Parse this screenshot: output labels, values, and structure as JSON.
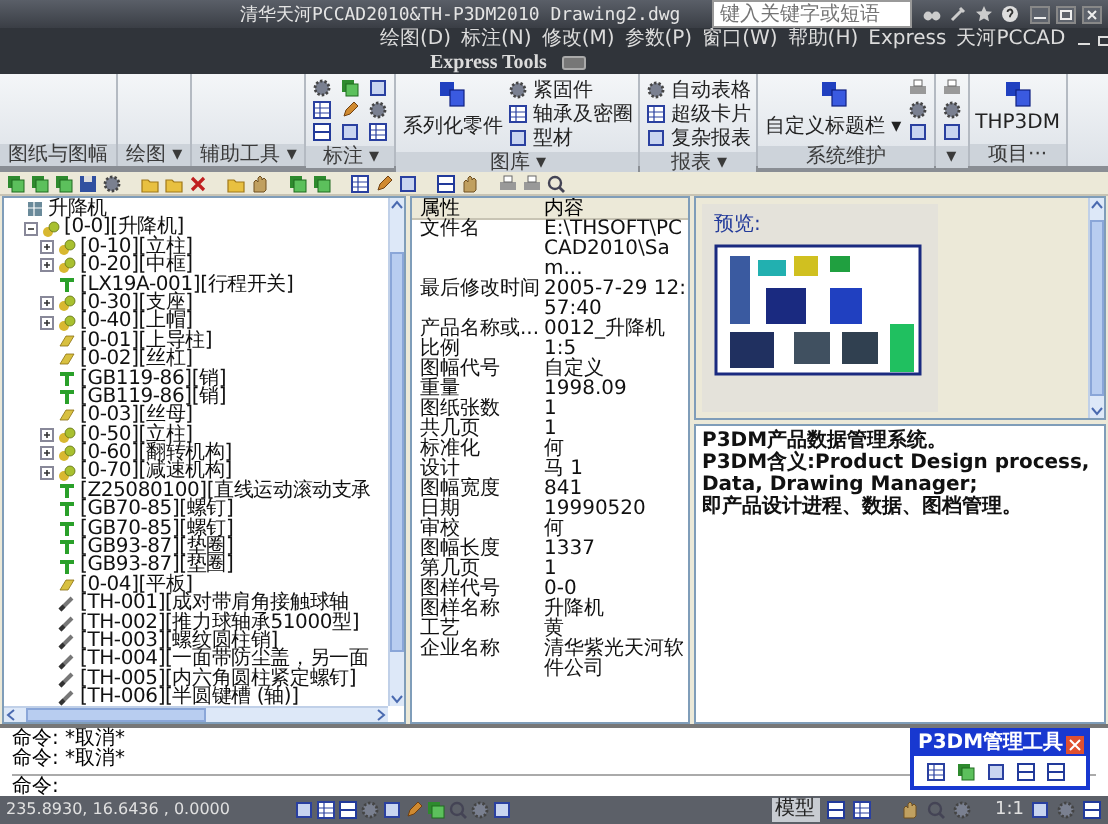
{
  "window": {
    "title": "清华天河PCCAD2010&TH-P3DM2010  Drawing2.dwg",
    "search": {
      "placeholder": "键入关键字或短语"
    }
  },
  "menu_bar": [
    "绘图(D)",
    "标注(N)",
    "修改(M)",
    "参数(P)",
    "窗口(W)",
    "帮助(H)",
    "Express",
    "天河PCCAD"
  ],
  "ribbon_tabs": [
    "Express Tools"
  ],
  "ribbon_panels": [
    {
      "title": "图纸与图幅",
      "kind": "empty"
    },
    {
      "title": "绘图 ▾",
      "kind": "empty"
    },
    {
      "title": "辅助工具 ▾",
      "kind": "empty"
    },
    {
      "title": "标注 ▾",
      "kind": "icon_grid"
    },
    {
      "title": "图库 ▾",
      "kind": "buttons",
      "large": "系列化零件",
      "buttons": [
        "紧固件",
        "轴承及密圈",
        "型材"
      ]
    },
    {
      "title": "报表 ▾",
      "kind": "buttons",
      "buttons": [
        "自动表格",
        "超级卡片",
        "复杂报表"
      ]
    },
    {
      "title": "系统维护",
      "kind": "icon_column",
      "large": "自定义标题栏 ▾"
    },
    {
      "title": "▾",
      "kind": "icon_column"
    },
    {
      "title": "项目···",
      "kind": "buttons",
      "large": "THP3DM"
    }
  ],
  "tree": {
    "label": "升降机",
    "kind": "model",
    "children": [
      {
        "label": "[0-0][升降机]",
        "kind": "assembly",
        "expanded": true,
        "children": [
          {
            "label": "[0-10][立柱]",
            "kind": "assembly",
            "expanded": false
          },
          {
            "label": "[0-20][中框]",
            "kind": "assembly",
            "expanded": false
          },
          {
            "label": "[LX19A-001][行程开关]",
            "kind": "part"
          },
          {
            "label": "[0-30][支座]",
            "kind": "assembly",
            "expanded": false
          },
          {
            "label": "[0-40][上帽]",
            "kind": "assembly",
            "expanded": false
          },
          {
            "label": "[0-01][上导柱]",
            "kind": "plate"
          },
          {
            "label": "[0-02][丝杠]",
            "kind": "plate"
          },
          {
            "label": "[GB119-86][销]",
            "kind": "part"
          },
          {
            "label": "[GB119-86][销]",
            "kind": "part"
          },
          {
            "label": "[0-03][丝母]",
            "kind": "plate"
          },
          {
            "label": "[0-50][立柱]",
            "kind": "assembly",
            "expanded": false
          },
          {
            "label": "[0-60][翻转机构]",
            "kind": "assembly",
            "expanded": false
          },
          {
            "label": "[0-70][减速机构]",
            "kind": "assembly",
            "expanded": false
          },
          {
            "label": "[Z25080100][直线运动滚动支承",
            "kind": "part"
          },
          {
            "label": "[GB70-85][螺钉]",
            "kind": "part"
          },
          {
            "label": "[GB70-85][螺钉]",
            "kind": "part"
          },
          {
            "label": "[GB93-87][垫圈]",
            "kind": "part"
          },
          {
            "label": "[GB93-87][垫圈]",
            "kind": "part"
          },
          {
            "label": "[0-04][平板]",
            "kind": "plate"
          },
          {
            "label": "[TH-001][成对带肩角接触球轴",
            "kind": "standard"
          },
          {
            "label": "[TH-002][推力球轴承51000型]",
            "kind": "standard"
          },
          {
            "label": "[TH-003][螺纹圆柱销]",
            "kind": "standard"
          },
          {
            "label": "[TH-004][一面带防尘盖，另一面",
            "kind": "standard"
          },
          {
            "label": "[TH-005][内六角圆柱紧定螺钉]",
            "kind": "standard"
          },
          {
            "label": "[TH-006][半圆键槽 (轴)]",
            "kind": "standard"
          }
        ]
      }
    ]
  },
  "properties": {
    "columns": [
      "属性",
      "内容"
    ],
    "rows": [
      {
        "name": "文件名",
        "value": "E:\\THSOFT\\PCCAD2010\\Sam..."
      },
      {
        "name": "最后修改时间",
        "value": "2005-7-29 12:57:40"
      },
      {
        "name": "产品名称或...",
        "value": "0012_升降机"
      },
      {
        "name": "比例",
        "value": "1:5"
      },
      {
        "name": "图幅代号",
        "value": "自定义"
      },
      {
        "name": "重量",
        "value": "1998.09"
      },
      {
        "name": "图纸张数",
        "value": "1"
      },
      {
        "name": "共几页",
        "value": "1"
      },
      {
        "name": "标准化",
        "value": "何"
      },
      {
        "name": "设计",
        "value": "马 1"
      },
      {
        "name": "图幅宽度",
        "value": "841"
      },
      {
        "name": "日期",
        "value": "19990520"
      },
      {
        "name": "审校",
        "value": "何"
      },
      {
        "name": "图幅长度",
        "value": "1337"
      },
      {
        "name": "第几页",
        "value": "1"
      },
      {
        "name": "图样代号",
        "value": "0-0"
      },
      {
        "name": "图样名称",
        "value": "升降机"
      },
      {
        "name": "工艺",
        "value": "黄"
      },
      {
        "name": "企业名称",
        "value": "清华紫光天河软件公司"
      }
    ]
  },
  "preview": {
    "label": "预览:",
    "description": [
      "P3DM产品数据管理系统。",
      "P3DM含义:Product Design process, Data, Drawing Manager;",
      "即产品设计进程、数据、图档管理。"
    ]
  },
  "command": {
    "history": [
      "命令: *取消*",
      "命令: *取消*"
    ],
    "prompt": "命令:"
  },
  "status_bar": {
    "coordinates": "235.8930, 16.6436 , 0.0000",
    "model_label": "模型",
    "scale": "1:1"
  },
  "palette": {
    "title": "P3DM管理工具"
  }
}
